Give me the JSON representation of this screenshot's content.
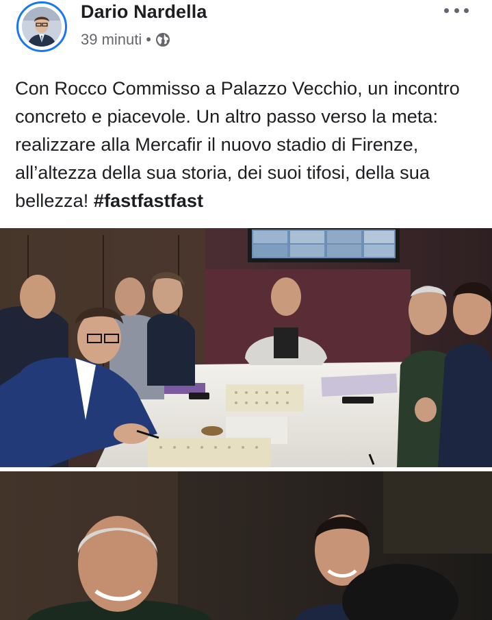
{
  "author": {
    "name": "Dario Nardella",
    "time": "39 minuti",
    "separator": "•"
  },
  "icons": {
    "audience": "globe-icon",
    "menu": "more-options-icon"
  },
  "post": {
    "text_main": "Con Rocco Commisso a Palazzo Vecchio, un incontro concreto e piacevole. Un altro passo verso la meta: realizzare alla Mercafir il nuovo stadio di Firenze, all’altezza della sua storia, dei suoi tifosi, della sua bellezza! ",
    "hashtag": "#fastfastfast"
  },
  "colors": {
    "accent": "#1877f2",
    "text": "#1c1e21",
    "secondary": "#65676b"
  }
}
